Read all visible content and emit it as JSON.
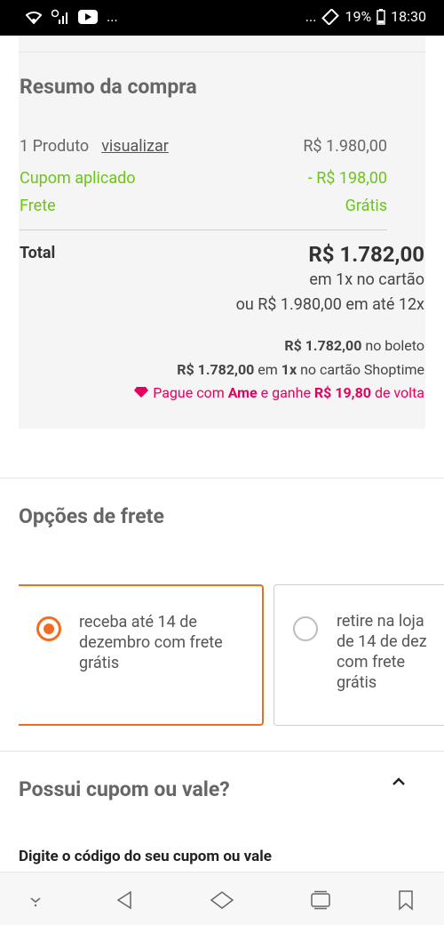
{
  "status_bar": {
    "battery": "19%",
    "time": "18:30",
    "dots_left": "...",
    "dots_right": "..."
  },
  "summary": {
    "title": "Resumo da compra",
    "product_label": "1 Produto",
    "view_link": "visualizar",
    "product_price": "R$ 1.980,00",
    "coupon_label": "Cupom aplicado",
    "coupon_value": "- R$ 198,00",
    "shipping_label": "Frete",
    "shipping_value": "Grátis",
    "total_label": "Total",
    "total_value": "R$ 1.782,00",
    "card_1x": "em 1x no cartão",
    "installments": "ou R$ 1.980,00 em até 12x",
    "boleto_value": "R$ 1.782,00",
    "boleto_text": " no boleto",
    "shoptime_value": "R$ 1.782,00",
    "shoptime_text_1": " em ",
    "shoptime_1x": "1x",
    "shoptime_text_2": " no cartão Shoptime",
    "ame_text_1": "Pague com ",
    "ame_brand": "Ame",
    "ame_text_2": " e ganhe ",
    "ame_value": "R$ 19,80",
    "ame_text_3": " de volta"
  },
  "shipping": {
    "title": "Opções de frete",
    "option_1": "receba até 14 de\ndezembro com frete\ngrátis",
    "option_2": "retire na loja\nde 14 de dez\ncom frete grátis"
  },
  "coupon": {
    "title": "Possui cupom ou vale?",
    "input_label": "Digite o código do seu cupom ou vale"
  },
  "colors": {
    "accent": "#f36d21",
    "green": "#6cc51b",
    "ame_pink": "#e5005d"
  }
}
